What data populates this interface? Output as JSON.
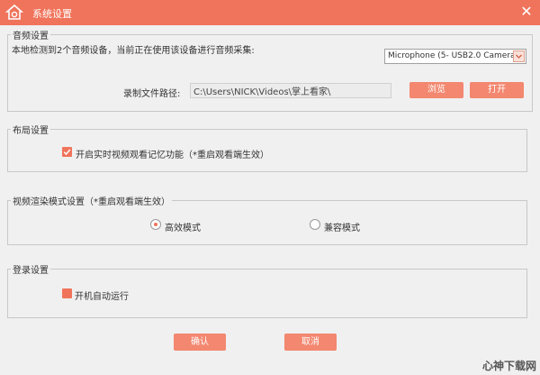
{
  "window": {
    "title": "系统设置",
    "close_glyph": "✕",
    "accent": "#f0745b"
  },
  "audio": {
    "legend": "音频设置",
    "detected_text": "本地检测到2个音频设备，当前正在使用该设备进行音频采集:",
    "device_selected": "Microphone (5- USB2.0 Camera)",
    "path_label": "录制文件路径:",
    "path_value": "C:\\Users\\NICK\\Videos\\掌上看家\\",
    "browse_label": "浏览",
    "open_label": "打开"
  },
  "layout": {
    "legend": "布局设置",
    "memory_label": "开启实时视频观看记忆功能（*重启观看端生效）",
    "memory_checked": true
  },
  "render": {
    "legend": "视频渲染模式设置（*重启观看端生效）",
    "options": [
      {
        "label": "高效模式",
        "selected": true
      },
      {
        "label": "兼容模式",
        "selected": false
      }
    ]
  },
  "login": {
    "legend": "登录设置",
    "autostart_label": "开机自动运行",
    "autostart_checked": true
  },
  "buttons": {
    "confirm_label": "确认",
    "cancel_label": "取消"
  },
  "watermark": {
    "text": "心神下载网"
  }
}
